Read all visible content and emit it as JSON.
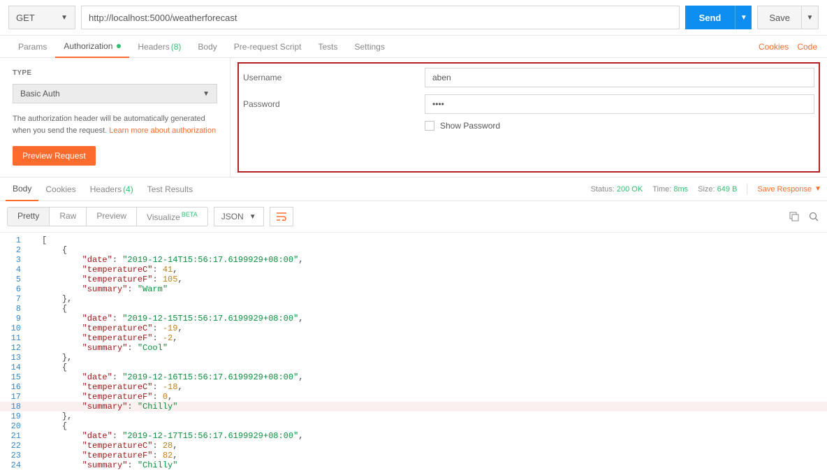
{
  "request": {
    "method": "GET",
    "url": "http://localhost:5000/weatherforecast",
    "send_label": "Send",
    "save_label": "Save"
  },
  "request_tabs": {
    "params": "Params",
    "authorization": "Authorization",
    "headers": "Headers",
    "headers_count": "(8)",
    "body": "Body",
    "prerequest": "Pre-request Script",
    "tests": "Tests",
    "settings": "Settings",
    "cookies": "Cookies",
    "code": "Code"
  },
  "auth": {
    "type_label": "TYPE",
    "type_value": "Basic Auth",
    "help_text_1": "The authorization header will be automatically generated when you send the request. ",
    "help_link": "Learn more about authorization",
    "preview_label": "Preview Request",
    "username_label": "Username",
    "username_value": "aben",
    "password_label": "Password",
    "password_value": "••••",
    "show_password": "Show Password"
  },
  "response_tabs": {
    "body": "Body",
    "cookies": "Cookies",
    "headers": "Headers",
    "headers_count": "(4)",
    "test_results": "Test Results"
  },
  "response_meta": {
    "status_label": "Status:",
    "status_value": "200 OK",
    "time_label": "Time:",
    "time_value": "8ms",
    "size_label": "Size:",
    "size_value": "649 B",
    "save_response": "Save Response"
  },
  "view": {
    "pretty": "Pretty",
    "raw": "Raw",
    "preview": "Preview",
    "visualize": "Visualize",
    "visualize_beta": "BETA",
    "format": "JSON"
  },
  "lines": [
    {
      "n": 1,
      "t": "["
    },
    {
      "n": 2,
      "t": "    {"
    },
    {
      "n": 3,
      "t": "        \"date\": \"2019-12-14T15:56:17.6199929+08:00\","
    },
    {
      "n": 4,
      "t": "        \"temperatureC\": 41,"
    },
    {
      "n": 5,
      "t": "        \"temperatureF\": 105,"
    },
    {
      "n": 6,
      "t": "        \"summary\": \"Warm\""
    },
    {
      "n": 7,
      "t": "    },"
    },
    {
      "n": 8,
      "t": "    {"
    },
    {
      "n": 9,
      "t": "        \"date\": \"2019-12-15T15:56:17.6199929+08:00\","
    },
    {
      "n": 10,
      "t": "        \"temperatureC\": -19,"
    },
    {
      "n": 11,
      "t": "        \"temperatureF\": -2,"
    },
    {
      "n": 12,
      "t": "        \"summary\": \"Cool\""
    },
    {
      "n": 13,
      "t": "    },"
    },
    {
      "n": 14,
      "t": "    {"
    },
    {
      "n": 15,
      "t": "        \"date\": \"2019-12-16T15:56:17.6199929+08:00\","
    },
    {
      "n": 16,
      "t": "        \"temperatureC\": -18,"
    },
    {
      "n": 17,
      "t": "        \"temperatureF\": 0,"
    },
    {
      "n": 18,
      "t": "        \"summary\": \"Chilly\"",
      "hl": true
    },
    {
      "n": 19,
      "t": "    },"
    },
    {
      "n": 20,
      "t": "    {"
    },
    {
      "n": 21,
      "t": "        \"date\": \"2019-12-17T15:56:17.6199929+08:00\","
    },
    {
      "n": 22,
      "t": "        \"temperatureC\": 28,"
    },
    {
      "n": 23,
      "t": "        \"temperatureF\": 82,"
    },
    {
      "n": 24,
      "t": "        \"summary\": \"Chilly\""
    }
  ]
}
